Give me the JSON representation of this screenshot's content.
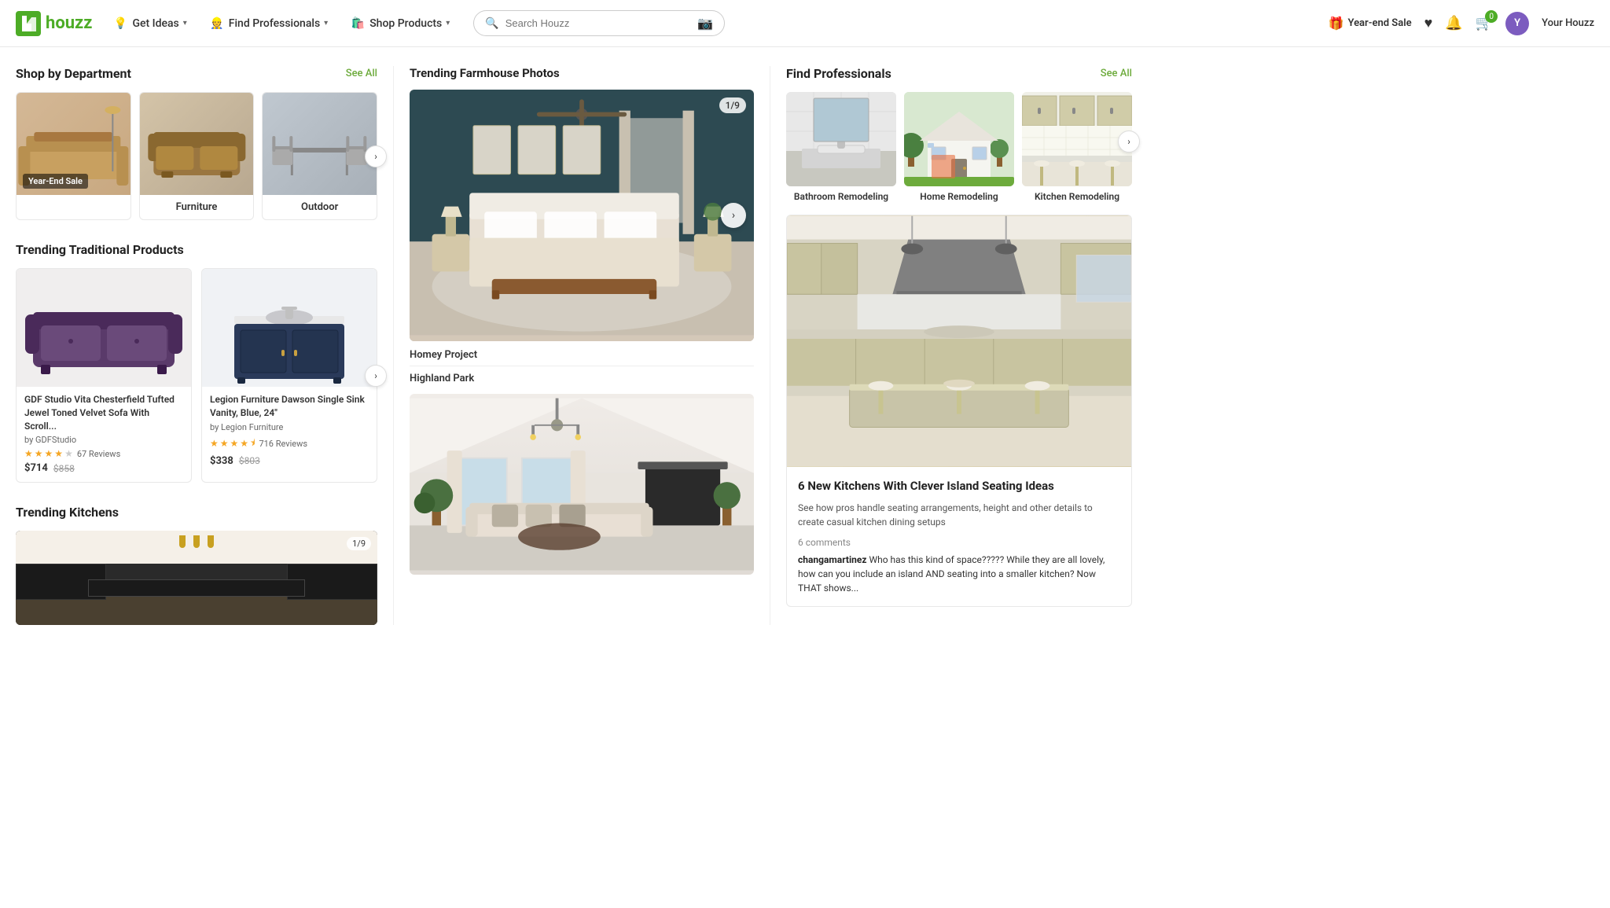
{
  "site": {
    "name": "houzz",
    "logo_letter": "h"
  },
  "nav": {
    "get_ideas": "Get Ideas",
    "find_professionals": "Find Professionals",
    "shop_products": "Shop Products",
    "search_placeholder": "Search Houzz",
    "year_end_sale": "Year-end Sale",
    "cart_count": "0",
    "your_houzz": "Your Houzz",
    "user_initial": "Y"
  },
  "shop_by_dept": {
    "title": "Shop by Department",
    "see_all": "See All",
    "items": [
      {
        "label": "Year-End Sale",
        "badge": "Year-End Sale",
        "has_badge": true
      },
      {
        "label": "Furniture",
        "has_badge": false
      },
      {
        "label": "Outdoor",
        "has_badge": false
      }
    ]
  },
  "trending_traditional": {
    "title": "Trending Traditional Products",
    "products": [
      {
        "name": "GDF Studio Vita Chesterfield Tufted Jewel Toned Velvet Sofa With Scroll...",
        "by": "by GDFStudio",
        "stars": 4,
        "half_star": false,
        "reviews": "67 Reviews",
        "price": "$714",
        "original_price": "$858"
      },
      {
        "name": "Legion Furniture Dawson Single Sink Vanity, Blue, 24\"",
        "by": "by Legion Furniture",
        "stars": 4,
        "half_star": true,
        "reviews": "716 Reviews",
        "price": "$338",
        "original_price": "$803"
      }
    ]
  },
  "trending_kitchens": {
    "title": "Trending Kitchens",
    "counter": "1/9"
  },
  "trending_farmhouse": {
    "title": "Trending Farmhouse Photos",
    "counter": "1/9",
    "photos": [
      {
        "label": "Homey Project"
      },
      {
        "label": "Highland Park"
      }
    ]
  },
  "find_professionals": {
    "title": "Find Professionals",
    "see_all": "See All",
    "categories": [
      {
        "label": "Bathroom Remodeling"
      },
      {
        "label": "Home Remodeling"
      },
      {
        "label": "Kitchen Remodeling"
      }
    ]
  },
  "article": {
    "title": "6 New Kitchens With Clever Island Seating Ideas",
    "subtitle": "See how pros handle seating arrangements, height and other details to create casual kitchen dining setups",
    "comments_count": "6 comments",
    "comment_author": "changamartinez",
    "comment_text": "Who has this kind of space????? While they are all lovely, how can you include an island AND seating into a smaller kitchen? Now THAT shows..."
  }
}
